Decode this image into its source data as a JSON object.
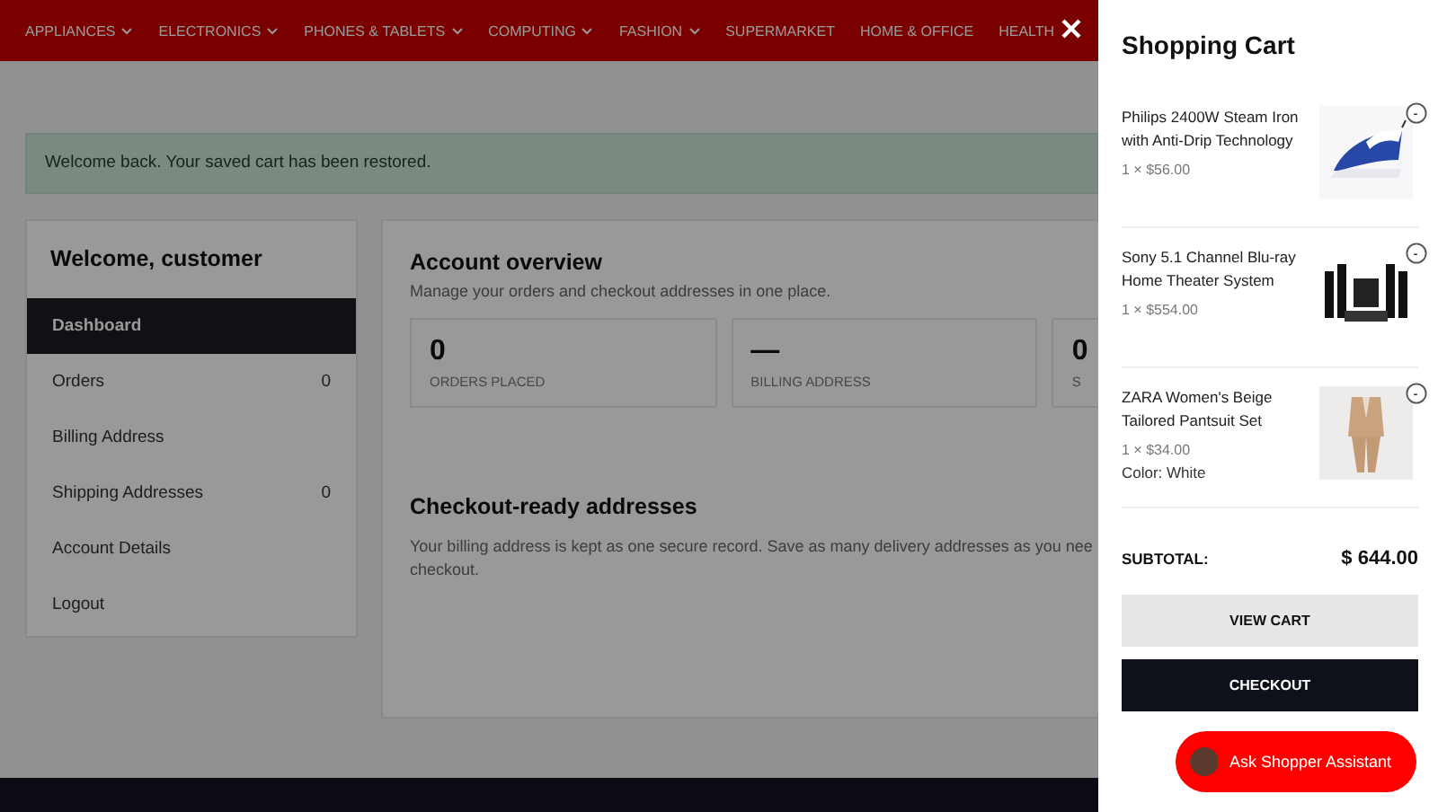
{
  "nav": [
    {
      "label": "APPLIANCES",
      "dropdown": true
    },
    {
      "label": "ELECTRONICS",
      "dropdown": true
    },
    {
      "label": "PHONES & TABLETS",
      "dropdown": true
    },
    {
      "label": "COMPUTING",
      "dropdown": true
    },
    {
      "label": "FASHION",
      "dropdown": true
    },
    {
      "label": "SUPERMARKET",
      "dropdown": false
    },
    {
      "label": "HOME & OFFICE",
      "dropdown": false
    },
    {
      "label": "HEALTH",
      "dropdown": false
    }
  ],
  "alert": "Welcome back. Your saved cart has been restored.",
  "sidebar": {
    "title": "Welcome, customer",
    "items": [
      {
        "label": "Dashboard",
        "selected": true
      },
      {
        "label": "Orders",
        "count": "0",
        "selected": false
      },
      {
        "label": "Billing Address",
        "selected": false
      },
      {
        "label": "Shipping Addresses",
        "count": "0",
        "selected": false
      },
      {
        "label": "Account Details",
        "selected": false
      },
      {
        "label": "Logout",
        "selected": false
      }
    ]
  },
  "overview": {
    "title": "Account overview",
    "subtitle": "Manage your orders and checkout addresses in one place.",
    "stats": [
      {
        "value": "0",
        "label": "ORDERS PLACED"
      },
      {
        "value": "—",
        "label": "BILLING ADDRESS"
      },
      {
        "value": "0",
        "label": "S"
      }
    ]
  },
  "addresses": {
    "title": "Checkout-ready addresses",
    "text_lines": [
      "Your billing address is kept as one secure record. Save as many delivery addresses as you nee",
      "checkout."
    ]
  },
  "cart": {
    "title": "Shopping Cart",
    "items": [
      {
        "name": "Philips 2400W Steam Iron with Anti-Drip Technology",
        "price": "1 × $56.00",
        "kind": "iron"
      },
      {
        "name": "Sony 5.1 Channel Blu-ray Home Theater System",
        "price": "1 × $554.00",
        "kind": "speakers"
      },
      {
        "name": "ZARA Women's Beige Tailored Pantsuit Set",
        "price": "1 × $34.00",
        "option": "Color: White",
        "kind": "suit"
      }
    ],
    "subtotal_label": "SUBTOTAL:",
    "subtotal": "$ 644.00",
    "view_cart": "VIEW CART",
    "checkout": "CHECKOUT"
  },
  "assistant": "Ask Shopper Assistant"
}
